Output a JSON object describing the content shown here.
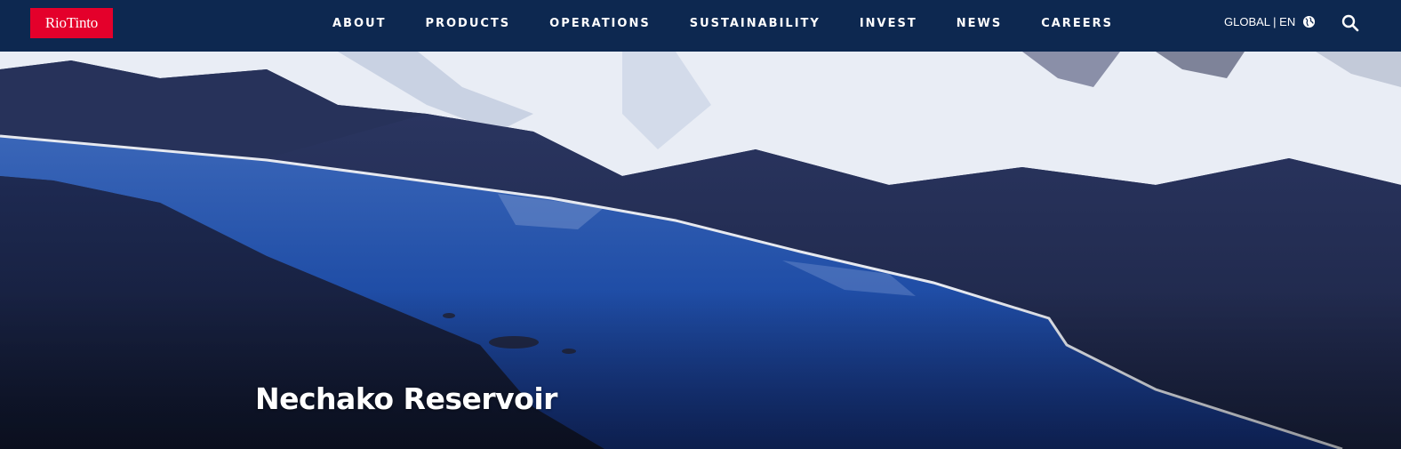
{
  "brand": {
    "logo_text": "RioTinto",
    "color": "#e4002b"
  },
  "header": {
    "background": "#0d2850"
  },
  "nav": {
    "items": [
      {
        "label": "ABOUT",
        "name": "nav-about"
      },
      {
        "label": "PRODUCTS",
        "name": "nav-products"
      },
      {
        "label": "OPERATIONS",
        "name": "nav-operations"
      },
      {
        "label": "SUSTAINABILITY",
        "name": "nav-sustainability"
      },
      {
        "label": "INVEST",
        "name": "nav-invest"
      },
      {
        "label": "NEWS",
        "name": "nav-news"
      },
      {
        "label": "CAREERS",
        "name": "nav-careers"
      }
    ]
  },
  "region": {
    "label": "GLOBAL | EN",
    "icon": "globe-icon"
  },
  "search": {
    "icon": "search-icon"
  },
  "hero": {
    "title": "Nechako Reservoir",
    "image": "aerial-lake-snow-mountains"
  }
}
